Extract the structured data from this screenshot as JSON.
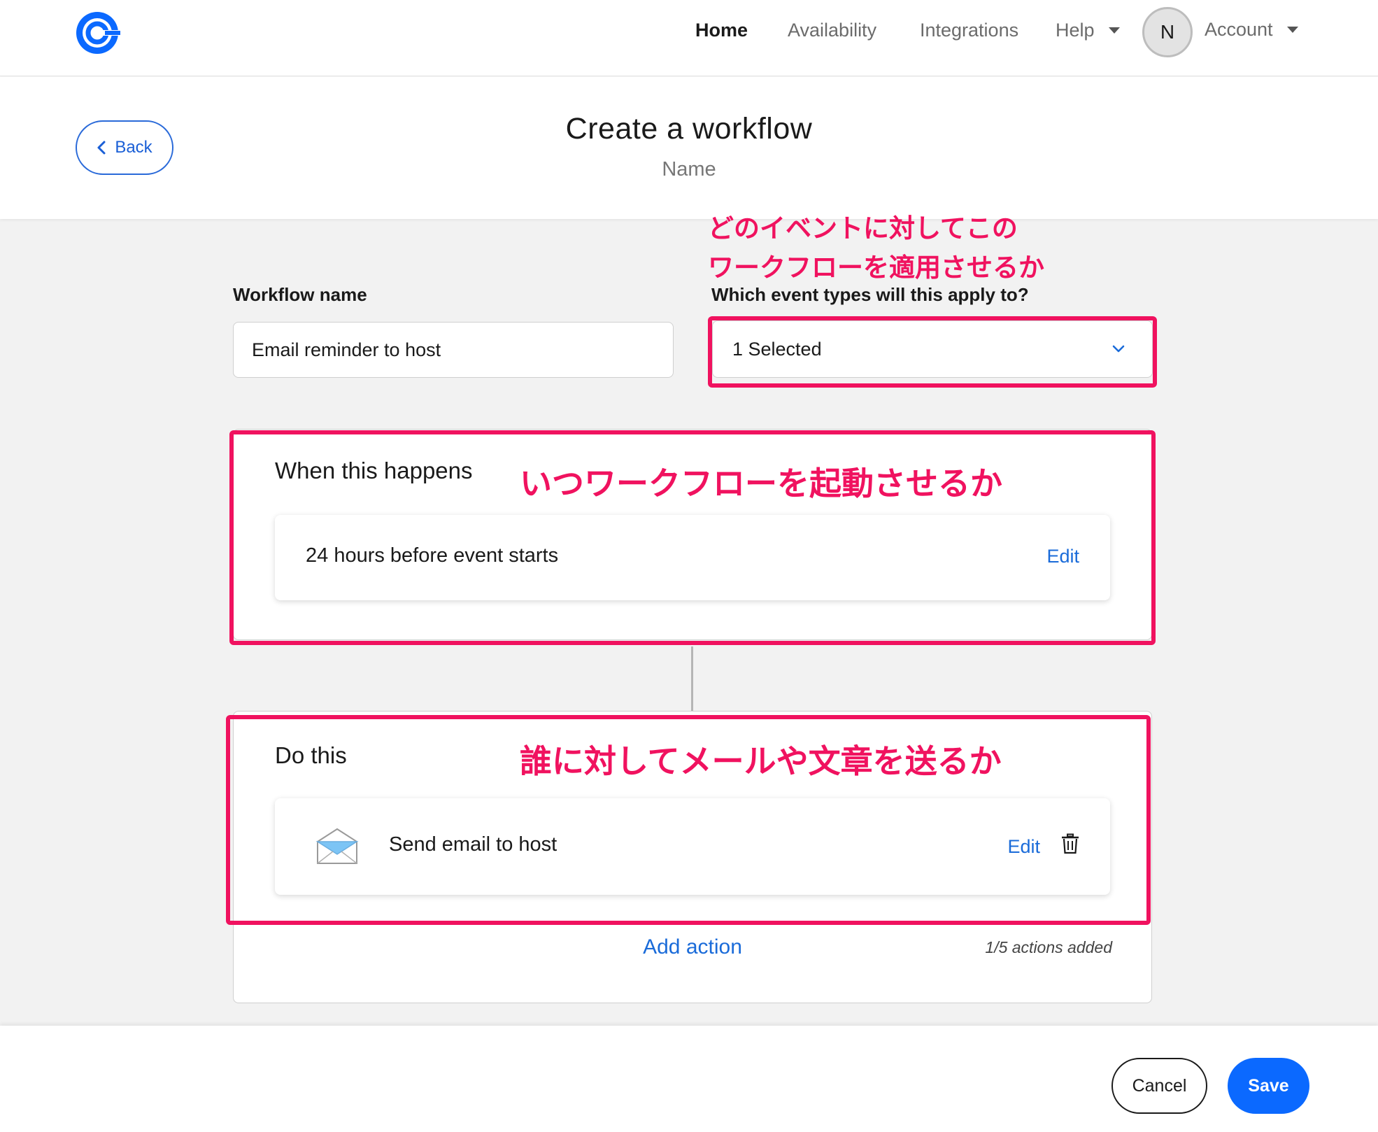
{
  "nav": {
    "items": [
      {
        "label": "Home",
        "active": true
      },
      {
        "label": "Availability",
        "active": false
      },
      {
        "label": "Integrations",
        "active": false
      },
      {
        "label": "Help",
        "active": false
      }
    ],
    "avatar_initial": "N",
    "account_label": "Account",
    "brand_color": "#0b69ff"
  },
  "header": {
    "back_label": "Back",
    "title": "Create a workflow",
    "subtitle": "Name"
  },
  "form": {
    "workflow_name_label": "Workflow name",
    "workflow_name_value": "Email reminder to host",
    "event_types_label": "Which event types will this apply to?",
    "event_types_value": "1 Selected"
  },
  "trigger": {
    "title": "When this happens",
    "value": "24 hours before event starts",
    "edit_label": "Edit"
  },
  "actions": {
    "title": "Do this",
    "items": [
      {
        "label": "Send email to host",
        "edit_label": "Edit",
        "icon": "envelope-icon"
      }
    ],
    "add_label": "Add action",
    "count_label": "1/5 actions added"
  },
  "annotations": {
    "event_line1": "どのイベントに対してこの",
    "event_line2": "ワークフローを適用させるか",
    "trigger_note": "いつワークフローを起動させるか",
    "action_note": "誰に対してメールや文章を送るか",
    "color": "#f0125f"
  },
  "footer": {
    "cancel_label": "Cancel",
    "save_label": "Save"
  }
}
